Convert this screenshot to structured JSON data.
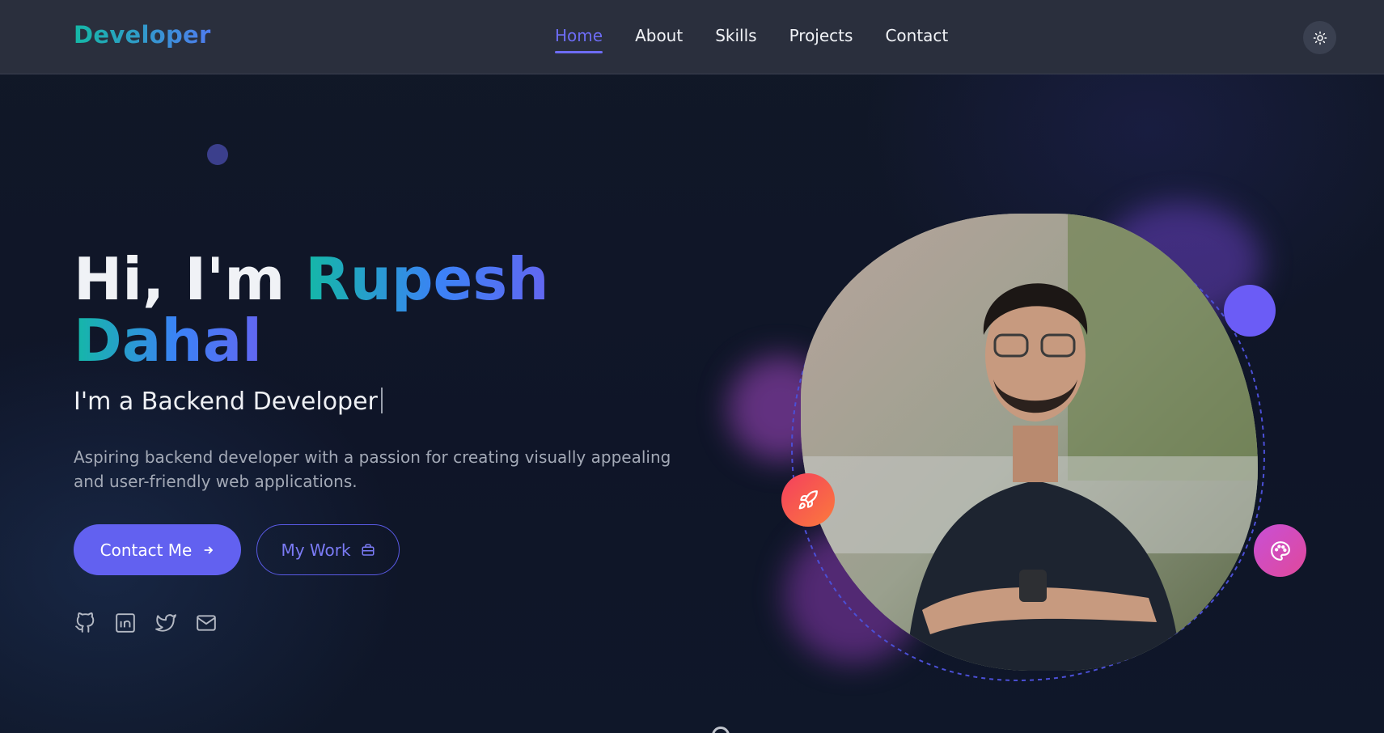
{
  "header": {
    "logo": "Developer",
    "nav": [
      {
        "label": "Home",
        "active": true
      },
      {
        "label": "About",
        "active": false
      },
      {
        "label": "Skills",
        "active": false
      },
      {
        "label": "Projects",
        "active": false
      },
      {
        "label": "Contact",
        "active": false
      }
    ],
    "theme_toggle_icon": "sun-icon"
  },
  "hero": {
    "greeting": "Hi, I'm ",
    "name_first": "Rupesh",
    "name_last": "Dahal",
    "role": "I'm a Backend Developer",
    "description": "Aspiring backend developer with a passion for creating visually appealing and user-friendly web applications.",
    "primary_button": {
      "label": "Contact Me",
      "icon": "arrow-right-icon"
    },
    "secondary_button": {
      "label": "My Work",
      "icon": "briefcase-icon"
    },
    "socials": [
      "github-icon",
      "linkedin-icon",
      "twitter-icon",
      "mail-icon"
    ]
  },
  "visual": {
    "portrait_icon": "portrait-photo",
    "floating_icons": [
      "rocket-icon",
      "palette-icon"
    ]
  },
  "colors": {
    "accent": "#6261f0",
    "teal": "#14b8a6",
    "header_bg": "#2a2f3d",
    "page_bg": "#0f1526"
  }
}
